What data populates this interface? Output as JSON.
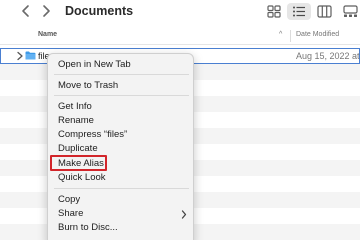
{
  "window": {
    "title": "Documents"
  },
  "toolbar": {
    "back_icon": "chevron-left-icon",
    "forward_icon": "chevron-right-icon",
    "views": [
      "icon-view-icon",
      "list-view-icon",
      "column-view-icon",
      "gallery-view-icon"
    ],
    "active_view": "list-view-icon"
  },
  "columns": {
    "name": "Name",
    "sort_indicator": "^",
    "date": "Date Modified"
  },
  "rows": [
    {
      "name": "files",
      "date": "Aug 15, 2022 at"
    }
  ],
  "context_menu": {
    "items": [
      "Open in New Tab",
      "Move to Trash",
      "Get Info",
      "Rename",
      "Compress “files”",
      "Duplicate",
      "Make Alias",
      "Quick Look",
      "Copy",
      "Share",
      "Burn to Disc..."
    ],
    "highlighted_item": "Make Alias",
    "highlight_color": "#d2252a"
  },
  "colors": {
    "selection_outline": "#4a7fd1",
    "folder": "#3d9ae8"
  }
}
